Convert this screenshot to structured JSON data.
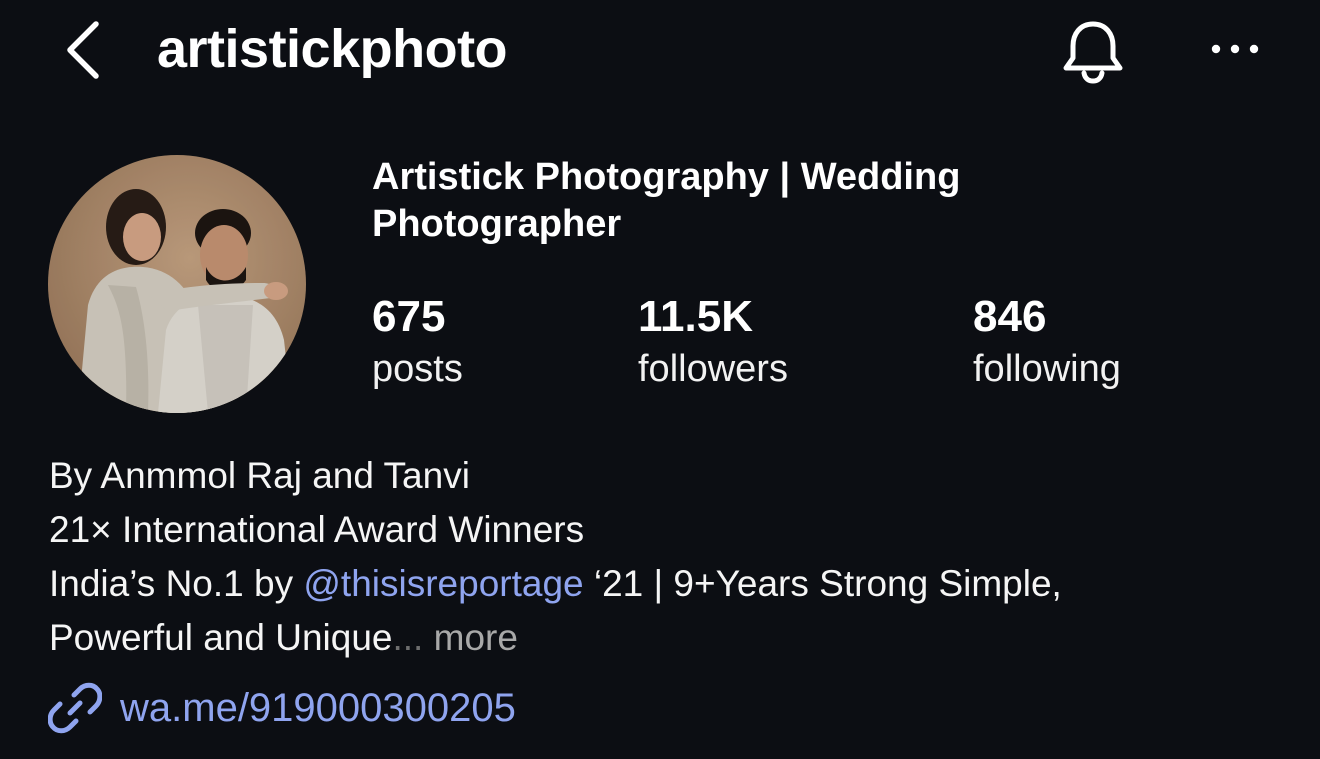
{
  "header": {
    "username": "artistickphoto",
    "back_icon": "chevron-left-icon",
    "bell_icon": "bell-icon",
    "more_icon": "ellipsis-horizontal-icon"
  },
  "profile": {
    "full_name": "Artistick Photography | Wedding Photographer",
    "avatar_alt": "profile photo of couple"
  },
  "stats": {
    "posts": {
      "value": "675",
      "label": "posts"
    },
    "followers": {
      "value": "11.5K",
      "label": "followers"
    },
    "following": {
      "value": "846",
      "label": "following"
    }
  },
  "bio": {
    "line1": "By Anmmol Raj and Tanvi",
    "line2": "21× International Award Winners",
    "line3_prefix": "India’s No.1 by ",
    "line3_mention": "@thisisreportage",
    "line3_suffix": " ‘21 | 9+Years Strong Simple,",
    "line4": "Powerful and Unique",
    "ellipsis": "...",
    "more_label": " more"
  },
  "link": {
    "icon": "link-icon",
    "url_text": "wa.me/919000300205"
  },
  "colors": {
    "background": "#0c0e13",
    "text": "#f5f5f5",
    "link": "#8fa4ef",
    "muted": "#a8a8a8"
  }
}
